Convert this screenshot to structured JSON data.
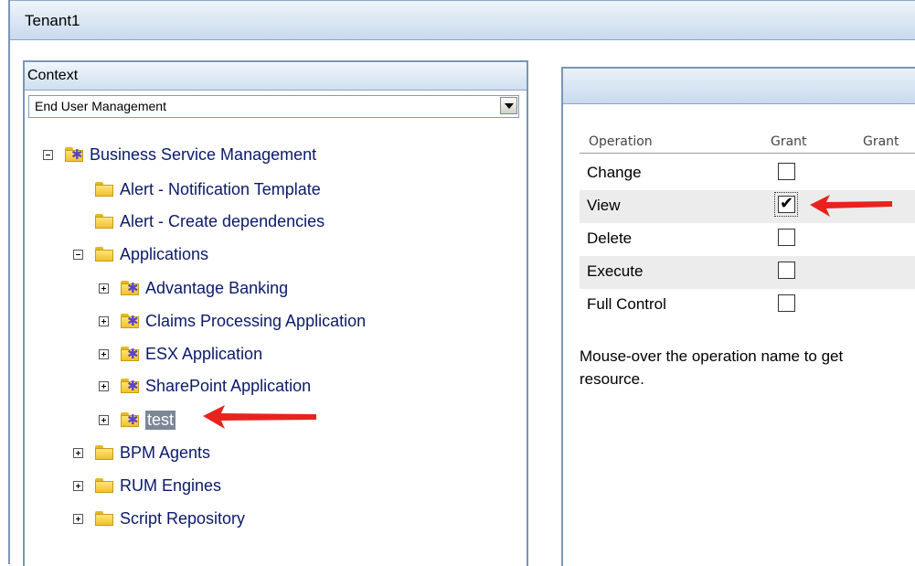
{
  "window": {
    "title": "Tenant1"
  },
  "context": {
    "header": "Context",
    "selected": "End User Management"
  },
  "tree": [
    {
      "label": "Business Service Management",
      "icon": "ci-folder-icon",
      "expander": "minus"
    },
    {
      "label": "Alert - Notification Template",
      "icon": "folder-icon",
      "expander": "none"
    },
    {
      "label": "Alert - Create dependencies",
      "icon": "folder-icon",
      "expander": "none"
    },
    {
      "label": "Applications",
      "icon": "folder-icon",
      "expander": "minus"
    },
    {
      "label": "Advantage Banking",
      "icon": "ci-folder-icon",
      "expander": "plus"
    },
    {
      "label": "Claims Processing Application",
      "icon": "ci-folder-icon",
      "expander": "plus"
    },
    {
      "label": "ESX Application",
      "icon": "ci-folder-icon",
      "expander": "plus"
    },
    {
      "label": "SharePoint Application",
      "icon": "ci-folder-icon",
      "expander": "plus"
    },
    {
      "label": "test",
      "icon": "ci-folder-icon",
      "expander": "plus",
      "selected": true
    },
    {
      "label": "BPM Agents",
      "icon": "folder-icon",
      "expander": "plus"
    },
    {
      "label": "RUM Engines",
      "icon": "folder-icon",
      "expander": "plus"
    },
    {
      "label": "Script Repository",
      "icon": "folder-icon",
      "expander": "plus"
    }
  ],
  "permissions": {
    "columns": [
      "Operation",
      "Grant",
      "Grant"
    ],
    "rows": [
      {
        "operation": "Change",
        "granted": false
      },
      {
        "operation": "View",
        "granted": true
      },
      {
        "operation": "Delete",
        "granted": false
      },
      {
        "operation": "Execute",
        "granted": false
      },
      {
        "operation": "Full Control",
        "granted": false
      }
    ],
    "note_line1": "Mouse-over the operation name to get",
    "note_line2": "resource."
  },
  "colors": {
    "arrow": "#e8231e",
    "selection": "#7c8796",
    "border": "#7a96b9"
  }
}
